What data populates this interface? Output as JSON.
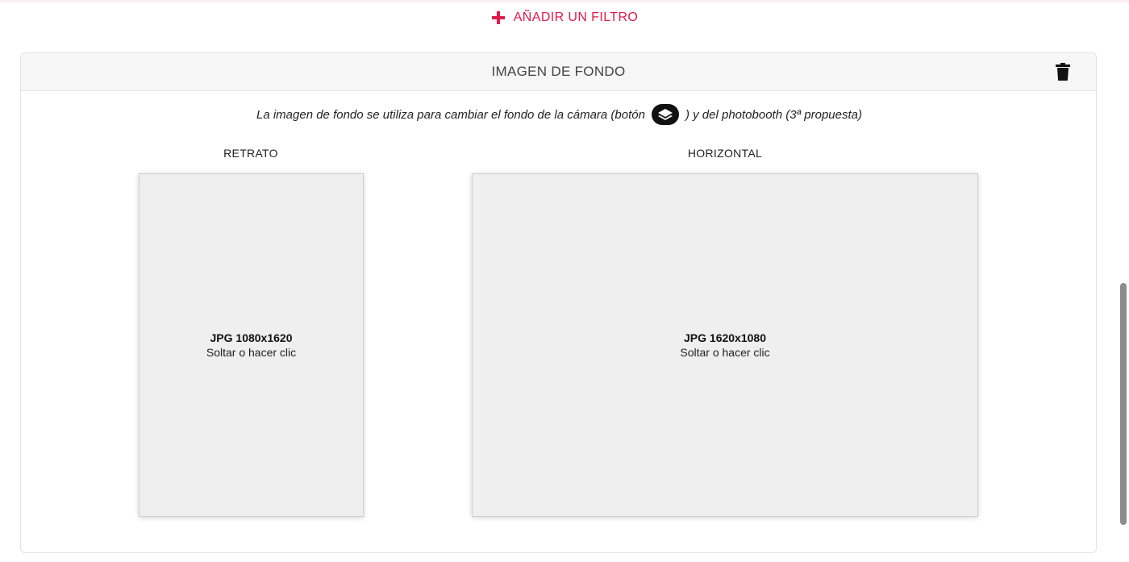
{
  "toolbar": {
    "add_filter_label": "AÑADIR UN FILTRO",
    "add_filter_icon": "plus-icon",
    "accent_color": "#e3194a"
  },
  "panel": {
    "title": "IMAGEN DE FONDO",
    "delete_icon": "trash-icon",
    "description_before": "La imagen de fondo se utiliza para cambiar el fondo de la cámara (botón",
    "description_icon": "layers-icon",
    "description_after": ") y del photobooth (3ª propuesta)",
    "portrait": {
      "label": "RETRATO",
      "format": "JPG 1080x1620",
      "hint": "Soltar o hacer clic"
    },
    "landscape": {
      "label": "HORIZONTAL",
      "format": "JPG 1620x1080",
      "hint": "Soltar o hacer clic"
    }
  }
}
